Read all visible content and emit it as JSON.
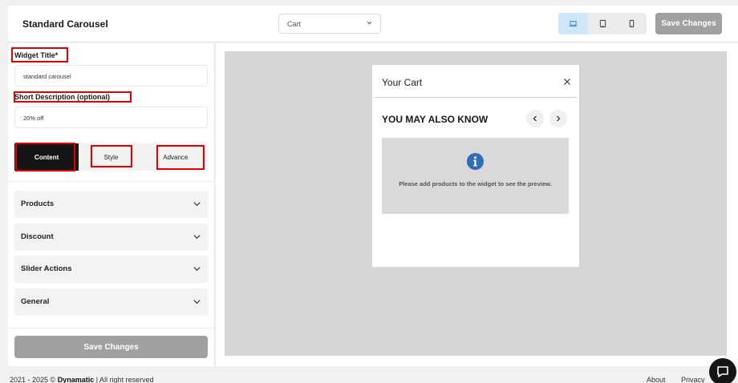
{
  "header": {
    "title": "Standard Carousel",
    "placement_select": "Cart",
    "save_label": "Save Changes"
  },
  "form": {
    "widget_title_label": "Widget Title*",
    "widget_title_value": "standard carousel",
    "short_desc_label": "Short Description (optional)",
    "short_desc_value": "20% off"
  },
  "tabs": [
    {
      "label": "Content",
      "active": true
    },
    {
      "label": "Style",
      "active": false
    },
    {
      "label": "Advance",
      "active": false
    }
  ],
  "accordion": [
    {
      "label": "Products"
    },
    {
      "label": "Discount"
    },
    {
      "label": "Slider Actions"
    },
    {
      "label": "General"
    }
  ],
  "panel_save_label": "Save Changes",
  "preview": {
    "cart_title": "Your Cart",
    "section_title": "YOU MAY ALSO KNOW",
    "empty_message": "Please add products to the widget to see the preview."
  },
  "footer": {
    "copyright_prefix": "2021 - 2025 © ",
    "brand": "Dynamatic",
    "copyright_suffix": " | All right reserved",
    "about": "About",
    "privacy": "Privacy"
  },
  "colors": {
    "accent_active_device": "#cfe7f9",
    "annotation_red": "#e60000",
    "button_disabled": "#a0a0a0",
    "info_blue": "#2f6db5"
  }
}
